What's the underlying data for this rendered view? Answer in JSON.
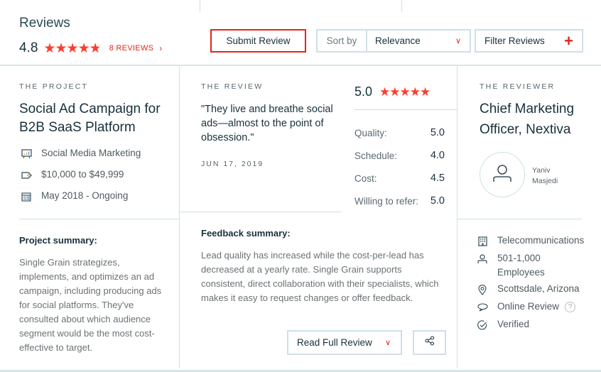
{
  "header": {
    "title": "Reviews",
    "overall_rating": "4.8",
    "overall_stars": 4.8,
    "reviews_link": "8 REVIEWS",
    "submit_label": "Submit Review",
    "sort_label": "Sort by",
    "sort_value": "Relevance",
    "filter_label": "Filter Reviews"
  },
  "project": {
    "eyebrow": "THE PROJECT",
    "title": "Social Ad Campaign for B2B SaaS Platform",
    "service": "Social Media Marketing",
    "budget": "$10,000 to $49,999",
    "dates": "May 2018 - Ongoing",
    "summary_label": "Project summary:",
    "summary": "Single Grain strategizes, implements, and optimizes an ad campaign, including producing ads for social platforms. They've consulted about which audience segment would be the most cost-effective to target."
  },
  "review": {
    "eyebrow": "THE REVIEW",
    "quote": "\"They live and breathe social ads—almost to the point of obsession.\"",
    "date": "JUN 17, 2019",
    "rating": "5.0",
    "rating_stars": 5,
    "scores": [
      {
        "label": "Quality:",
        "value": "5.0"
      },
      {
        "label": "Schedule:",
        "value": "4.0"
      },
      {
        "label": "Cost:",
        "value": "4.5"
      },
      {
        "label": "Willing to refer:",
        "value": "5.0"
      }
    ],
    "feedback_label": "Feedback summary:",
    "feedback": "Lead quality has increased while the cost-per-lead has decreased at a yearly rate. Single Grain supports consistent, direct collaboration with their specialists, which makes it easy to request changes or offer feedback.",
    "read_full_label": "Read Full Review"
  },
  "reviewer": {
    "eyebrow": "THE REVIEWER",
    "title": "Chief Marketing Officer, Nextiva",
    "name_first": "Yaniv",
    "name_last": "Masjedi",
    "industry": "Telecommunications",
    "employees": "501-1,000 Employees",
    "location": "Scottsdale, Arizona",
    "review_type": "Online Review",
    "verified": "Verified",
    "help_glyph": "?"
  },
  "icons": {
    "star": "★",
    "chevron_right": "›",
    "chevron_down": "∨",
    "plus": "+"
  },
  "colors": {
    "accent": "#e62415",
    "star": "#ff3d2e",
    "border": "#cee0e6",
    "text": "#17313b"
  }
}
